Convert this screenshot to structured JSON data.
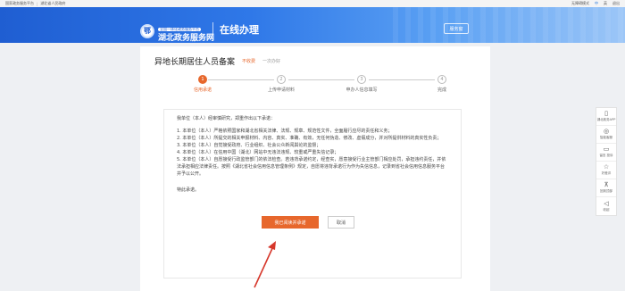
{
  "topbar": {
    "left_links": [
      "国家政务服务平台",
      "湖北省人民政府"
    ],
    "right_links": [
      "无障碍模式",
      "中",
      "英",
      "退出"
    ]
  },
  "header": {
    "logo_small": "全国一体化政务服务平台",
    "logo_big": "湖北政务服务网",
    "section_title": "在线办理",
    "service_button": "服务窗"
  },
  "page": {
    "title": "异地长期居住人员备案",
    "tag_fee": "不收费",
    "tag_once": "一次办好"
  },
  "steps": [
    {
      "num": "1",
      "label": "信用承诺",
      "active": true
    },
    {
      "num": "2",
      "label": "上传申请材料",
      "active": false
    },
    {
      "num": "3",
      "label": "申办人信息填写",
      "active": false
    },
    {
      "num": "4",
      "label": "完成",
      "active": false
    }
  ],
  "pledge": {
    "intro": "我单位（本人）经审慎研究，郑重作出以下承诺：",
    "items": [
      "1. 本单位（本人）严格依照国家和湖北省相关法律、法规、规章、规范性文件，全面履行应尽的责任和义务；",
      "2. 本单位（本人）所提交的相关申报材料、内容、真实、准确、有效，无任何伪造、修改、虚假成分，并对所提供材料的真实性负责；",
      "3. 本单位（本人）自觉接受政府、行业组织、社会公众新闻舆论的监督；",
      "4. 本单位（本人）在信用中国（湖北）网站中无违法违规、较重或严重失信记录；",
      "5. 本单位（本人）自愿接受行政监管部门的依法检查。若违背承诺约定，经查实，愿意接受行业主管部门相应处罚，承担违约责任，并依法承担相应法律责任。按照《湖北省社会信用信息管理条例》规定，自愿将违背承诺行为作为失信信息，记录到省社会信用信息服务平台并予以公开。"
    ],
    "closing": "特此承诺。"
  },
  "actions": {
    "confirm": "我已阅读并承诺",
    "cancel": "取消"
  },
  "rightbar": [
    {
      "icon": "phone-icon",
      "glyph": "▯",
      "label": "湖北政务APP"
    },
    {
      "icon": "robot-icon",
      "glyph": "◎",
      "label": "智能客服"
    },
    {
      "icon": "chat-icon",
      "glyph": "▭",
      "label": "留言 投诉"
    },
    {
      "icon": "star-icon",
      "glyph": "☆",
      "label": "好差评"
    },
    {
      "icon": "top-icon",
      "glyph": "⊼",
      "label": "回到顶部"
    },
    {
      "icon": "collapse-icon",
      "glyph": "◁",
      "label": "收起"
    }
  ],
  "colors": {
    "accent": "#e7672c",
    "header_blue": "#1f5ed2",
    "arrow": "#d6372b"
  }
}
